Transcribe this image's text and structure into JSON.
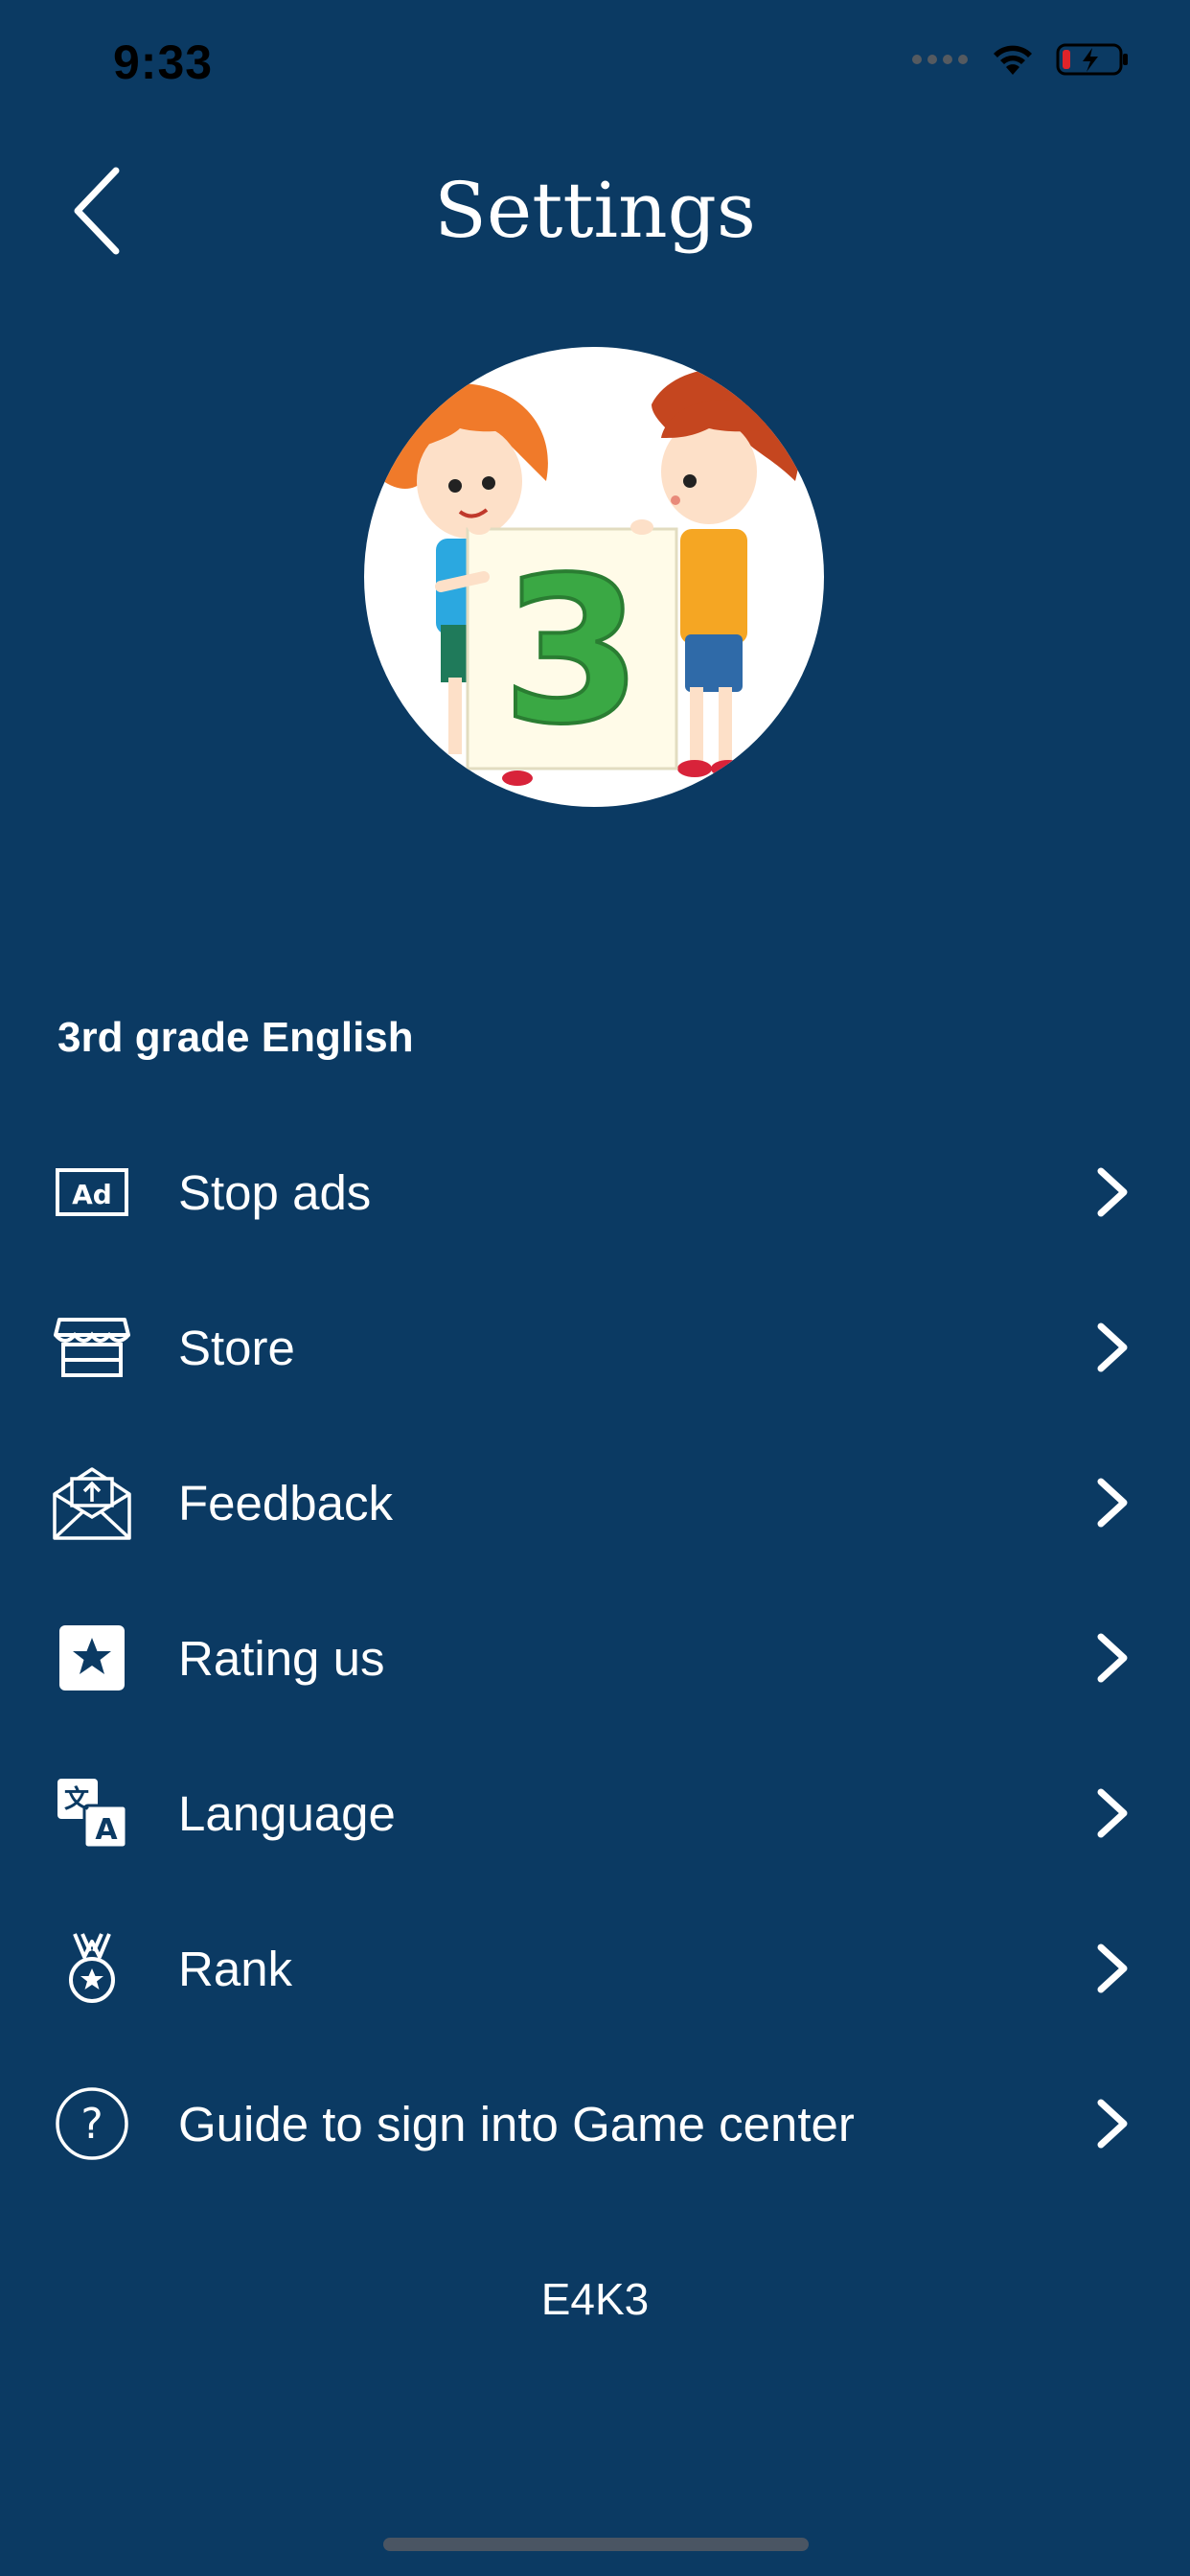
{
  "status_bar": {
    "time": "9:33"
  },
  "header": {
    "title": "Settings"
  },
  "section": {
    "title": "3rd grade English"
  },
  "hero": {
    "grade_number": "3"
  },
  "menu": {
    "items": [
      {
        "label": "Stop ads",
        "icon": "ad-icon"
      },
      {
        "label": "Store",
        "icon": "store-icon"
      },
      {
        "label": "Feedback",
        "icon": "feedback-mail-icon"
      },
      {
        "label": "Rating us",
        "icon": "star-icon"
      },
      {
        "label": "Language",
        "icon": "translate-icon"
      },
      {
        "label": "Rank",
        "icon": "medal-icon"
      },
      {
        "label": "Guide to sign into Game center",
        "icon": "question-icon"
      }
    ]
  },
  "footer": {
    "code": "E4K3"
  },
  "colors": {
    "background": "#0b3a63",
    "text": "#ffffff"
  }
}
